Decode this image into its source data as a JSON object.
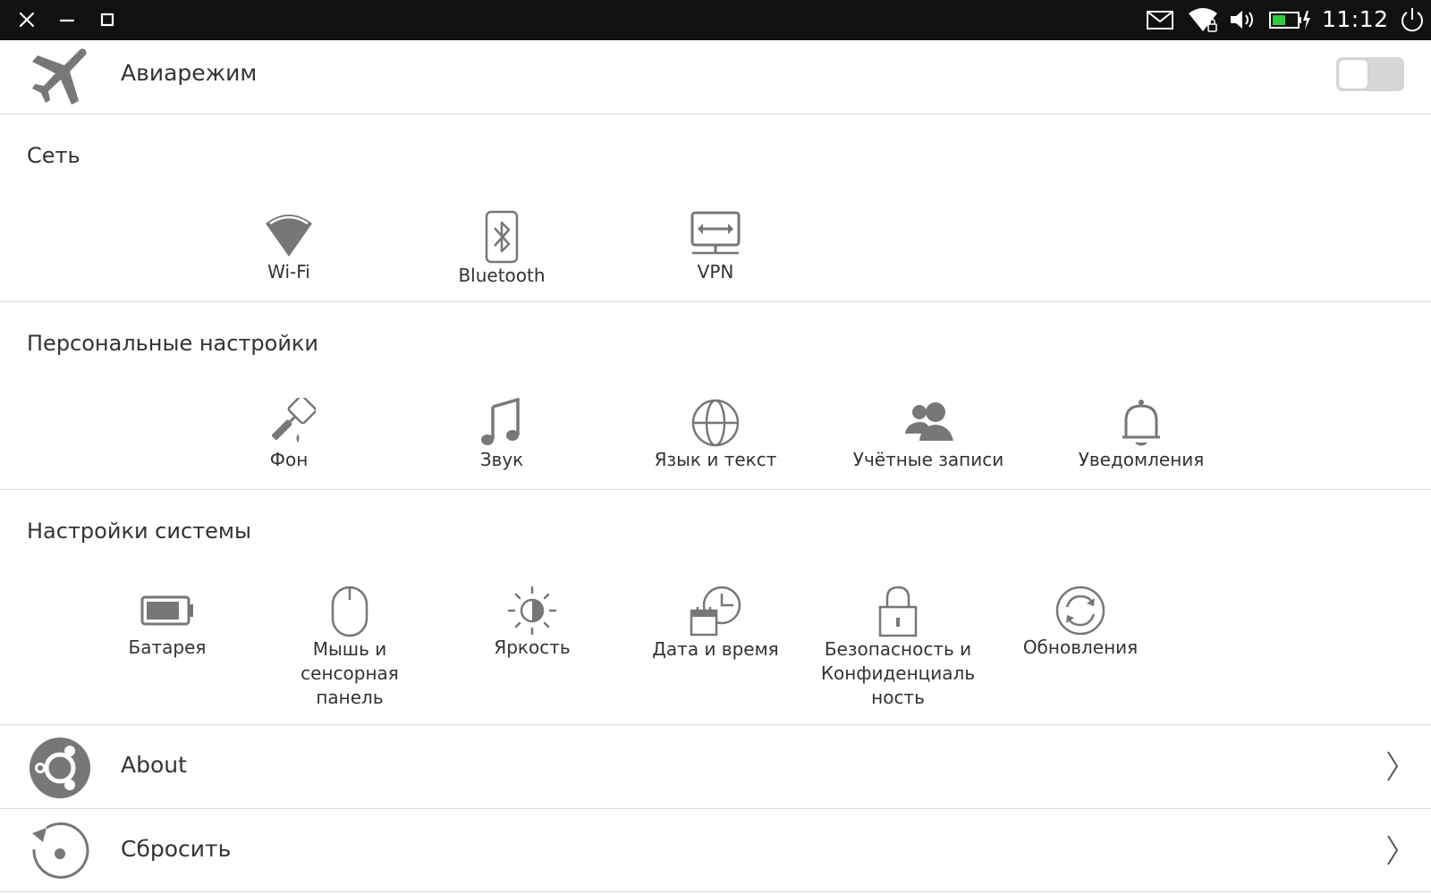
{
  "status_bar": {
    "time": "11:12",
    "icons": [
      "close-icon",
      "minimize-icon",
      "maximize-icon",
      "mail-icon",
      "wifi-icon",
      "volume-icon",
      "battery-charging-icon",
      "power-icon"
    ]
  },
  "airplane": {
    "label": "Авиарежим",
    "icon": "airplane-icon",
    "enabled": false
  },
  "sections": {
    "network": {
      "title": "Сеть",
      "items": [
        {
          "label": "Wi-Fi",
          "icon": "wifi-icon"
        },
        {
          "label": "Bluetooth",
          "icon": "bluetooth-icon"
        },
        {
          "label": "VPN",
          "icon": "vpn-icon"
        }
      ]
    },
    "personal": {
      "title": "Персональные настройки",
      "items": [
        {
          "label": "Фон",
          "icon": "paint-roller-icon"
        },
        {
          "label": "Звук",
          "icon": "music-note-icon"
        },
        {
          "label": "Язык и текст",
          "icon": "globe-icon"
        },
        {
          "label": "Учётные записи",
          "icon": "accounts-icon"
        },
        {
          "label": "Уведомления",
          "icon": "bell-icon"
        }
      ]
    },
    "system": {
      "title": "Настройки системы",
      "items": [
        {
          "label": "Батарея",
          "icon": "battery-icon"
        },
        {
          "label": "Мышь и\nсенсорная\nпанель",
          "icon": "mouse-icon"
        },
        {
          "label": "Яркость",
          "icon": "brightness-icon"
        },
        {
          "label": "Дата и время",
          "icon": "date-time-icon"
        },
        {
          "label": "Безопасность и\nКонфиденциаль\nность",
          "icon": "lock-icon"
        },
        {
          "label": "Обновления",
          "icon": "update-icon"
        }
      ]
    }
  },
  "nav_rows": [
    {
      "label": "About",
      "icon": "ubuntu-logo-icon"
    },
    {
      "label": "Сбросить",
      "icon": "reset-icon"
    }
  ],
  "colors": {
    "top_bar": "#111111",
    "icon_gray": "#777777",
    "divider": "#dcdcdc",
    "battery_green": "#2ecc40"
  }
}
